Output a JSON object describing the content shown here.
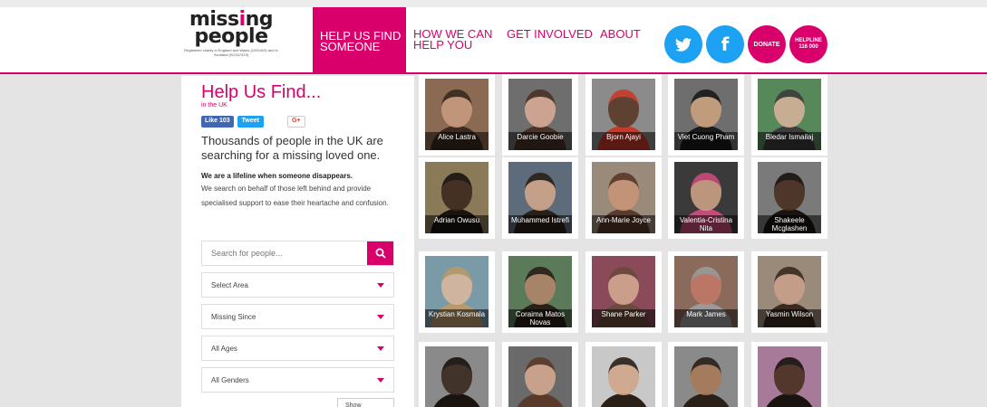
{
  "header": {
    "logo_line1": "missing",
    "logo_line2": "people",
    "logo_sub": "Registered charity in England and Wales (1020419) and in Scotland (SC047419)",
    "nav": [
      {
        "label": "HELP US FIND SOMEONE",
        "active": true
      },
      {
        "label": "HOW WE CAN HELP YOU"
      },
      {
        "label": "GET INVOLVED"
      },
      {
        "label": "ABOUT"
      }
    ],
    "social": {
      "twitter": "twitter-icon",
      "facebook": "facebook-icon"
    },
    "donate_label": "DONATE",
    "helpline_label": "HELPLINE",
    "helpline_number": "116 000"
  },
  "panel": {
    "title": "Help Us Find...",
    "subtitle": "in the UK",
    "like_label": "Like 103",
    "tweet_label": "Tweet",
    "gplus_label": "G+",
    "lead": "Thousands of people in the UK are searching for a missing loved one.",
    "strong": "We are a lifeline when someone disappears.",
    "body": "We search on behalf of those left behind and provide specialised support to ease their heartache and confusion.",
    "search_placeholder": "Search for people...",
    "selects": [
      "Select Area",
      "Missing Since",
      "All Ages",
      "All Genders"
    ],
    "more_label": "Show"
  },
  "people": [
    {
      "name": "Alice Lastra",
      "skin": "#c79a7e",
      "hair": "#3a2a20",
      "bg": "#8a6a52"
    },
    {
      "name": "Darcie Goobie",
      "skin": "#d7a895",
      "hair": "#4a3328",
      "bg": "#6e6e6e"
    },
    {
      "name": "Bjorn Ajayi",
      "skin": "#5a3a28",
      "hair": "#c73a2a",
      "bg": "#8b8b8b"
    },
    {
      "name": "Viet Cuong Pham",
      "skin": "#c9a27e",
      "hair": "#1a1a1a",
      "bg": "#6e6e6e"
    },
    {
      "name": "Bledar Ismailaj",
      "skin": "#d4b39a",
      "hair": "#3d3d3d",
      "bg": "#57885a"
    },
    {
      "name": "Adrian Owusu",
      "skin": "#3d2a1e",
      "hair": "#1a1410",
      "bg": "#8a7a58"
    },
    {
      "name": "Muhammed Istrefi",
      "skin": "#d0a68a",
      "hair": "#2a2018",
      "bg": "#5e6b7a"
    },
    {
      "name": "Ann-Marie Joyce",
      "skin": "#c89478",
      "hair": "#5a3a2a",
      "bg": "#9a8a7a"
    },
    {
      "name": "Valentia-Cristina Nita",
      "skin": "#c9a085",
      "hair": "#c84a7a",
      "bg": "#3a3a3a"
    },
    {
      "name": "Shakeele Mcglashen",
      "skin": "#4a3022",
      "hair": "#1a1410",
      "bg": "#7a7a7a"
    },
    {
      "name": "Krystian Kosmala",
      "skin": "#d9b8a0",
      "hair": "#b89a6a",
      "bg": "#7a9aa8"
    },
    {
      "name": "Coraima Matos Novas",
      "skin": "#b0866a",
      "hair": "#2a2018",
      "bg": "#5a7a5a"
    },
    {
      "name": "Shane Parker",
      "skin": "#d2a890",
      "hair": "#6a4a3a",
      "bg": "#8a4a5a"
    },
    {
      "name": "Mark James",
      "skin": "#c27868",
      "hair": "#9a9a9a",
      "bg": "#8a6a5a"
    },
    {
      "name": "Yasmin Wilson",
      "skin": "#c8a08a",
      "hair": "#3a2a20",
      "bg": "#9a8a7a"
    },
    {
      "name": "",
      "skin": "#3a2a20",
      "hair": "#1a1410",
      "bg": "#8a8a8a"
    },
    {
      "name": "",
      "skin": "#d2a890",
      "hair": "#5a3a2a",
      "bg": "#6a6a6a"
    },
    {
      "name": "",
      "skin": "#d0a68a",
      "hair": "#2a2018",
      "bg": "#c8c8c8"
    },
    {
      "name": "",
      "skin": "#a87a5a",
      "hair": "#2a2018",
      "bg": "#8a8a8a"
    },
    {
      "name": "",
      "skin": "#4a3022",
      "hair": "#1a1410",
      "bg": "#a87a9a"
    }
  ],
  "colors": {
    "brand": "#d9006c",
    "twitter": "#1da1f2"
  }
}
